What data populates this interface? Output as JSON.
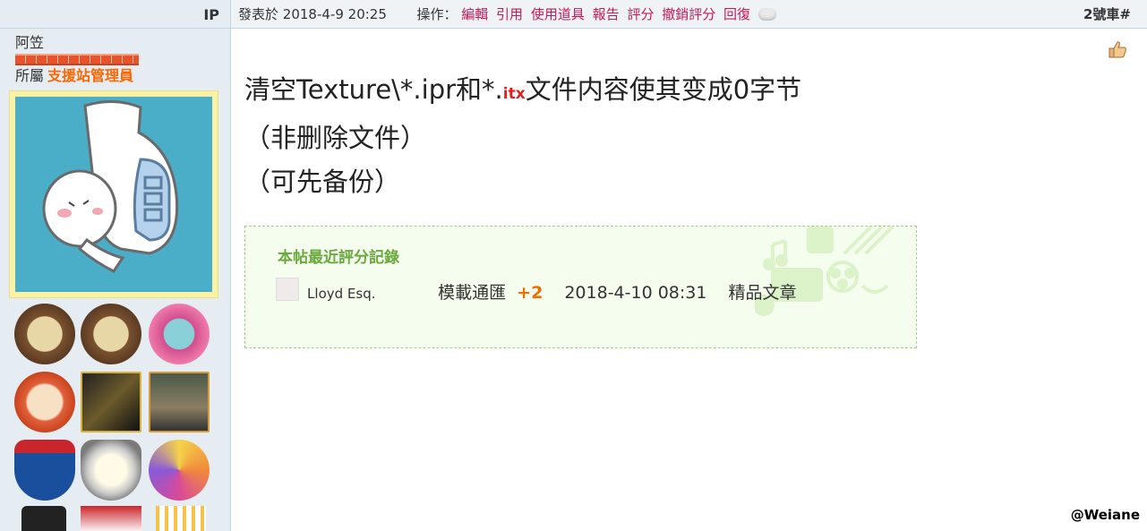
{
  "sidebar": {
    "ip_label": "IP",
    "username": "阿笠",
    "group_prefix": "所屬",
    "group_name": "支援站管理員",
    "medals": [
      "终身成就",
      "特殊贡献",
      "热心会员",
      "6th Anniversary",
      "IRO TR",
      "Bus",
      "7th",
      "8",
      "8 Ring",
      "Truck",
      "Sign",
      "Candles"
    ]
  },
  "post_header": {
    "posted_prefix": "發表於",
    "posted_time": "2018-4-9 20:25",
    "actions_label": "操作：",
    "actions": [
      "編輯",
      "引用",
      "使用道具",
      "報告",
      "評分",
      "撤銷評分",
      "回復"
    ],
    "floor": "2號車#"
  },
  "post": {
    "line1_a": "清空Texture\\*.ipr和*.",
    "line1_itx": "itx",
    "line1_b": "文件内容使其变成0字节",
    "line2": "（非删除文件）",
    "line3": "（可先备份）"
  },
  "rating": {
    "title": "本帖最近評分記錄",
    "entries": [
      {
        "user": "Lloyd Esq.",
        "type": "模載通匯",
        "score": "+2",
        "date": "2018-4-10 08:31",
        "reason": "精品文章"
      }
    ]
  },
  "watermark": "@Weiane",
  "colors": {
    "link": "#c6195a",
    "group": "#ff6600",
    "rating_title": "#6aa93e",
    "score": "#f26c00"
  }
}
